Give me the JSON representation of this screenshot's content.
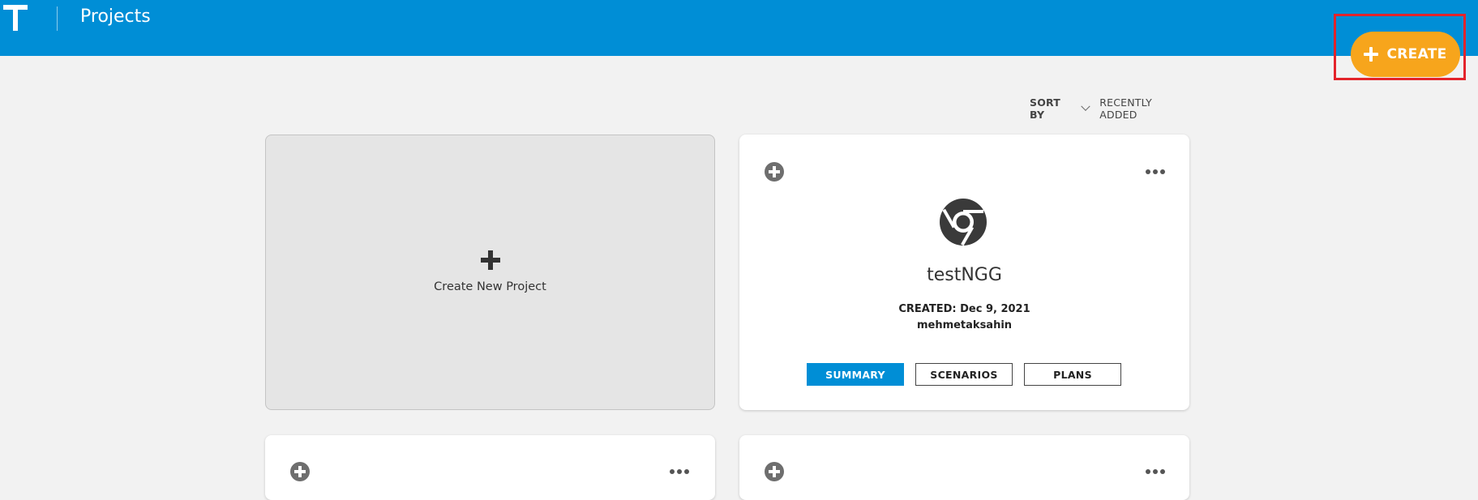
{
  "header": {
    "logo_text": "T",
    "title": "Projects",
    "create_label": "CREATE",
    "create_color": "#f7a51c",
    "bar_color": "#008ed6"
  },
  "sort": {
    "label": "SORT BY",
    "value": "RECENTLY ADDED"
  },
  "new_project": {
    "label": "Create New Project"
  },
  "projects": [
    {
      "name": "testNGG",
      "created_label": "CREATED:",
      "created_date": "Dec 9, 2021",
      "owner": "mehmetaksahin",
      "icon": "chrome-icon",
      "buttons": {
        "summary": "SUMMARY",
        "scenarios": "SCENARIOS",
        "plans": "PLANS"
      }
    }
  ]
}
